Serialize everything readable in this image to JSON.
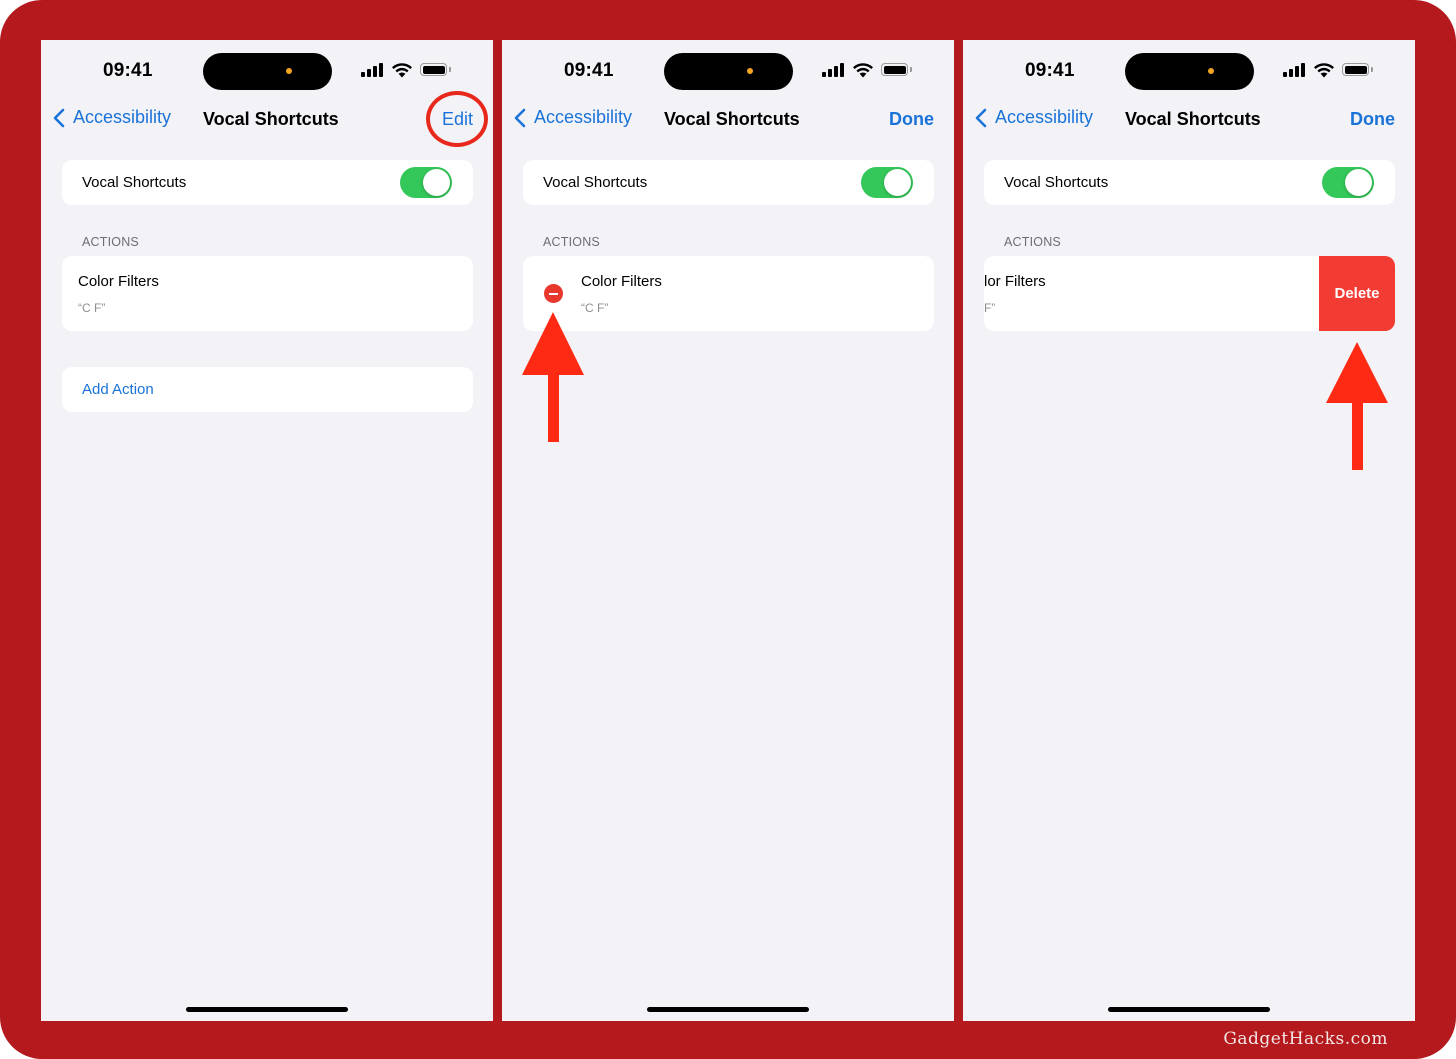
{
  "watermark": "GadgetHacks.com",
  "colors": {
    "frame": "#b3191d",
    "accent_blue": "#1a73d9",
    "toggle_green": "#34c759",
    "destructive_red": "#f23b32",
    "annotation_red": "#e8281c"
  },
  "panels": [
    {
      "status": {
        "time": "09:41"
      },
      "nav": {
        "back_label": "Accessibility",
        "title": "Vocal Shortcuts",
        "right_button": "Edit"
      },
      "toggle": {
        "label": "Vocal Shortcuts",
        "on": true
      },
      "section_header": "ACTIONS",
      "action": {
        "title": "Color Filters",
        "phrase": "“C F”"
      },
      "add_action": "Add Action",
      "annotation": "circle around Edit"
    },
    {
      "status": {
        "time": "09:41"
      },
      "nav": {
        "back_label": "Accessibility",
        "title": "Vocal Shortcuts",
        "right_button": "Done"
      },
      "toggle": {
        "label": "Vocal Shortcuts",
        "on": true
      },
      "section_header": "ACTIONS",
      "action": {
        "title": "Color Filters",
        "phrase": "“C F”"
      },
      "annotation": "arrow pointing to remove button"
    },
    {
      "status": {
        "time": "09:41"
      },
      "nav": {
        "back_label": "Accessibility",
        "title": "Vocal Shortcuts",
        "right_button": "Done"
      },
      "toggle": {
        "label": "Vocal Shortcuts",
        "on": true
      },
      "section_header": "ACTIONS",
      "action": {
        "title": "lor Filters",
        "phrase": "F”"
      },
      "delete_label": "Delete",
      "annotation": "arrow pointing to Delete button"
    }
  ]
}
